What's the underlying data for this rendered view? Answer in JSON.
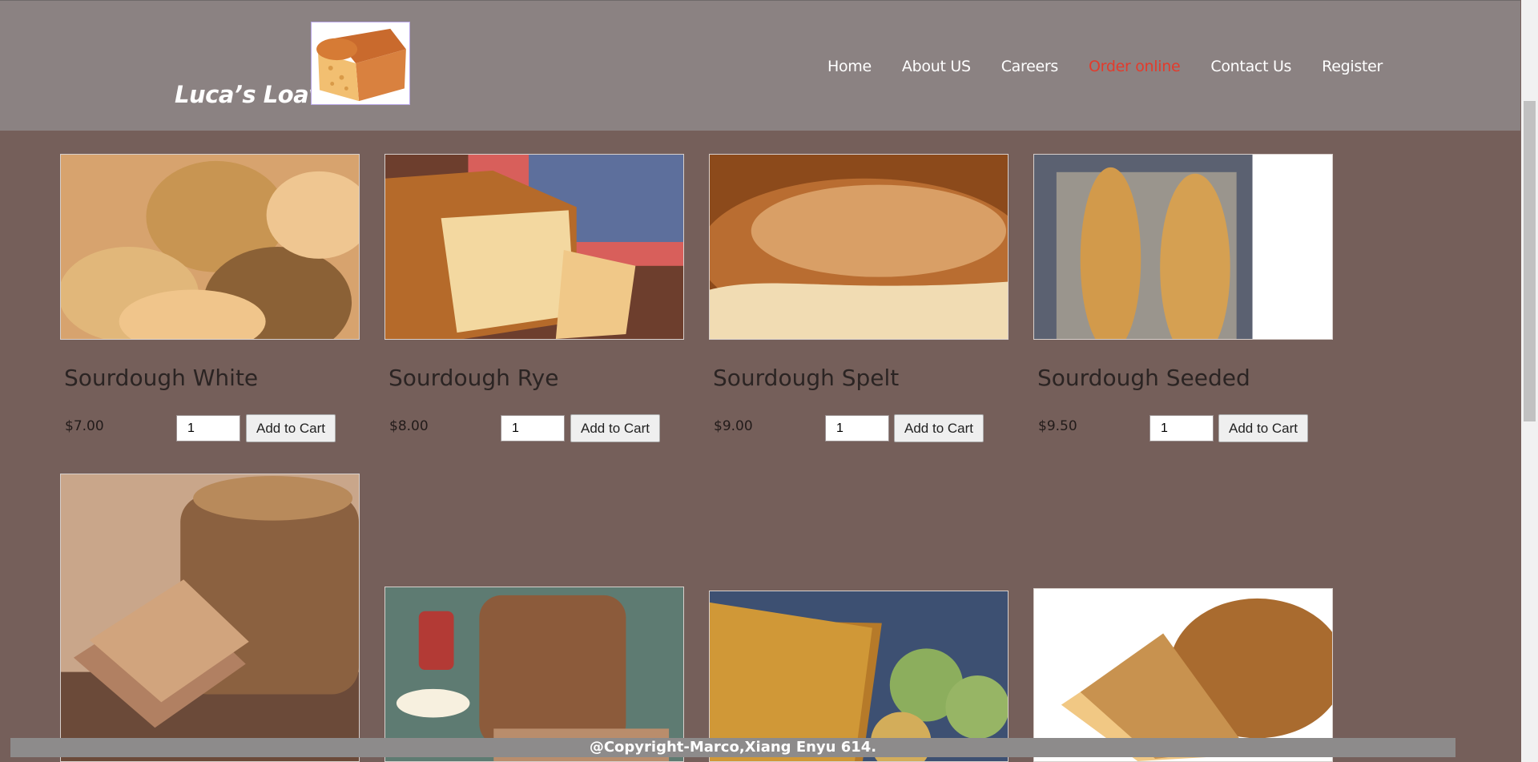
{
  "brand": {
    "name": "Luca’s Loaves"
  },
  "nav": [
    "Home",
    "About US",
    "Careers",
    "Order online",
    "Contact Us",
    "Register"
  ],
  "nav_active": "Order online",
  "products": [
    {
      "name": "Sourdough White",
      "price": "$7.00",
      "qty": "1",
      "button": "Add to Cart"
    },
    {
      "name": "Sourdough Rye",
      "price": "$8.00",
      "qty": "1",
      "button": "Add to Cart"
    },
    {
      "name": "Sourdough Spelt",
      "price": "$9.00",
      "qty": "1",
      "button": "Add to Cart"
    },
    {
      "name": "Sourdough Seeded",
      "price": "$9.50",
      "qty": "1",
      "button": "Add to Cart"
    }
  ],
  "footer": {
    "text": "@Copyright-Marco,Xiang Enyu 614."
  },
  "colors": {
    "header": "#8b8282",
    "page": "#755f5a",
    "active_nav": "#e33b2c"
  },
  "icons": [
    "bread-logo-icon"
  ]
}
